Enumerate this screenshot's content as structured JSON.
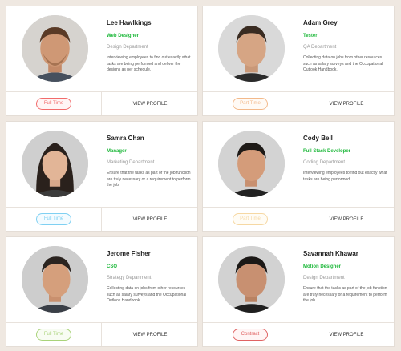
{
  "profiles": [
    {
      "name": "Lee Hawlkings",
      "role": "Web Designer",
      "department": "Design Department",
      "description": "Interviewing employees to find out exactly what tasks are being performed and deliver the designs as per schedule.",
      "status": "Full Time",
      "status_color": "#f26b6b",
      "status_bg": "#fff5f5",
      "action": "VIEW PROFILE"
    },
    {
      "name": "Adam Grey",
      "role": "Tester",
      "department": "QA Department",
      "description": "Collecting data on jobs from other resources such as salary surveys and the Occupational Outlook Handbook.",
      "status": "Part Time",
      "status_color": "#f3b98a",
      "status_bg": "#fffaf5",
      "action": "VIEW PROFILE"
    },
    {
      "name": "Samra Chan",
      "role": "Manager",
      "department": "Marketing Department",
      "description": "Ensure that the tasks as part of the job function are truly necessary or a requirement to perform the job.",
      "status": "Full Time",
      "status_color": "#7fd0f2",
      "status_bg": "#f3fbff",
      "action": "VIEW PROFILE"
    },
    {
      "name": "Cody Bell",
      "role": "Full Stack Developer",
      "department": "Coding Department",
      "description": "Interviewing employees to find out exactly what tasks are being performed.",
      "status": "Part Time",
      "status_color": "#f6d8a3",
      "status_bg": "#fffcf5",
      "action": "VIEW PROFILE"
    },
    {
      "name": "Jerome Fisher",
      "role": "CSO",
      "department": "Strategy Department",
      "description": "Collecting data on jobs from other resources such as salary surveys and the Occupational Outlook Handbook.",
      "status": "Full Time",
      "status_color": "#a9d37a",
      "status_bg": "#f8fcf3",
      "action": "VIEW PROFILE"
    },
    {
      "name": "Savannah Khawar",
      "role": "Motion Designer",
      "department": "Design Department",
      "description": "Ensure that the tasks as part of the job function are truly necessary or a requirement to perform the job.",
      "status": "Contract",
      "status_color": "#e06262",
      "status_bg": "#fff5f5",
      "action": "VIEW PROFILE"
    }
  ]
}
